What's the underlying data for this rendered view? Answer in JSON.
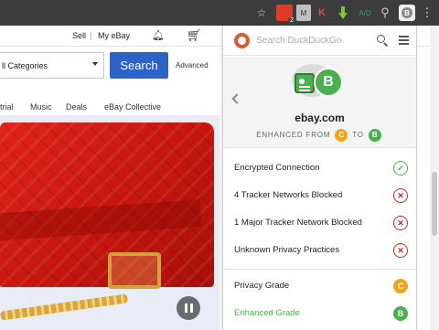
{
  "browser": {
    "extension_badge_count": "2",
    "ext_gray_label": "M",
    "ext_k_label": "K",
    "ext_abp_label": "A/D",
    "ddg_ext_grade": "B"
  },
  "ebay": {
    "nav": {
      "sell": "Sell",
      "separator": "|",
      "my_ebay": "My eBay"
    },
    "category_select": "ll Categories",
    "search_button": "Search",
    "advanced_link": "Advanced",
    "categories": [
      "trial",
      "Music",
      "Deals",
      "eBay Collective"
    ]
  },
  "popup": {
    "search_placeholder": "Search DuckDuckGo",
    "site": "ebay.com",
    "grade": "B",
    "enhanced_from_label": "ENHANCED FROM",
    "enhanced_to_label": "TO",
    "from_grade": "C",
    "to_grade": "B",
    "rows": [
      {
        "label": "Encrypted Connection",
        "status": "ok",
        "icon": "✓"
      },
      {
        "label": "4 Tracker Networks Blocked",
        "status": "bad",
        "icon": "✕"
      },
      {
        "label": "1 Major Tracker Network Blocked",
        "status": "bad",
        "icon": "✕"
      },
      {
        "label": "Unknown Privacy Practices",
        "status": "bad",
        "icon": "✕"
      }
    ],
    "privacy_grade_label": "Privacy Grade",
    "privacy_grade": "C",
    "enhanced_grade_label": "Enhanced Grade",
    "enhanced_grade": "B"
  },
  "colors": {
    "ok": "#4caf50",
    "bad": "#c72c2c",
    "grade_c": "#f2a31b",
    "grade_b": "#4caf50",
    "ebay_blue": "#2d63c8",
    "ddg_orange": "#de5833"
  }
}
